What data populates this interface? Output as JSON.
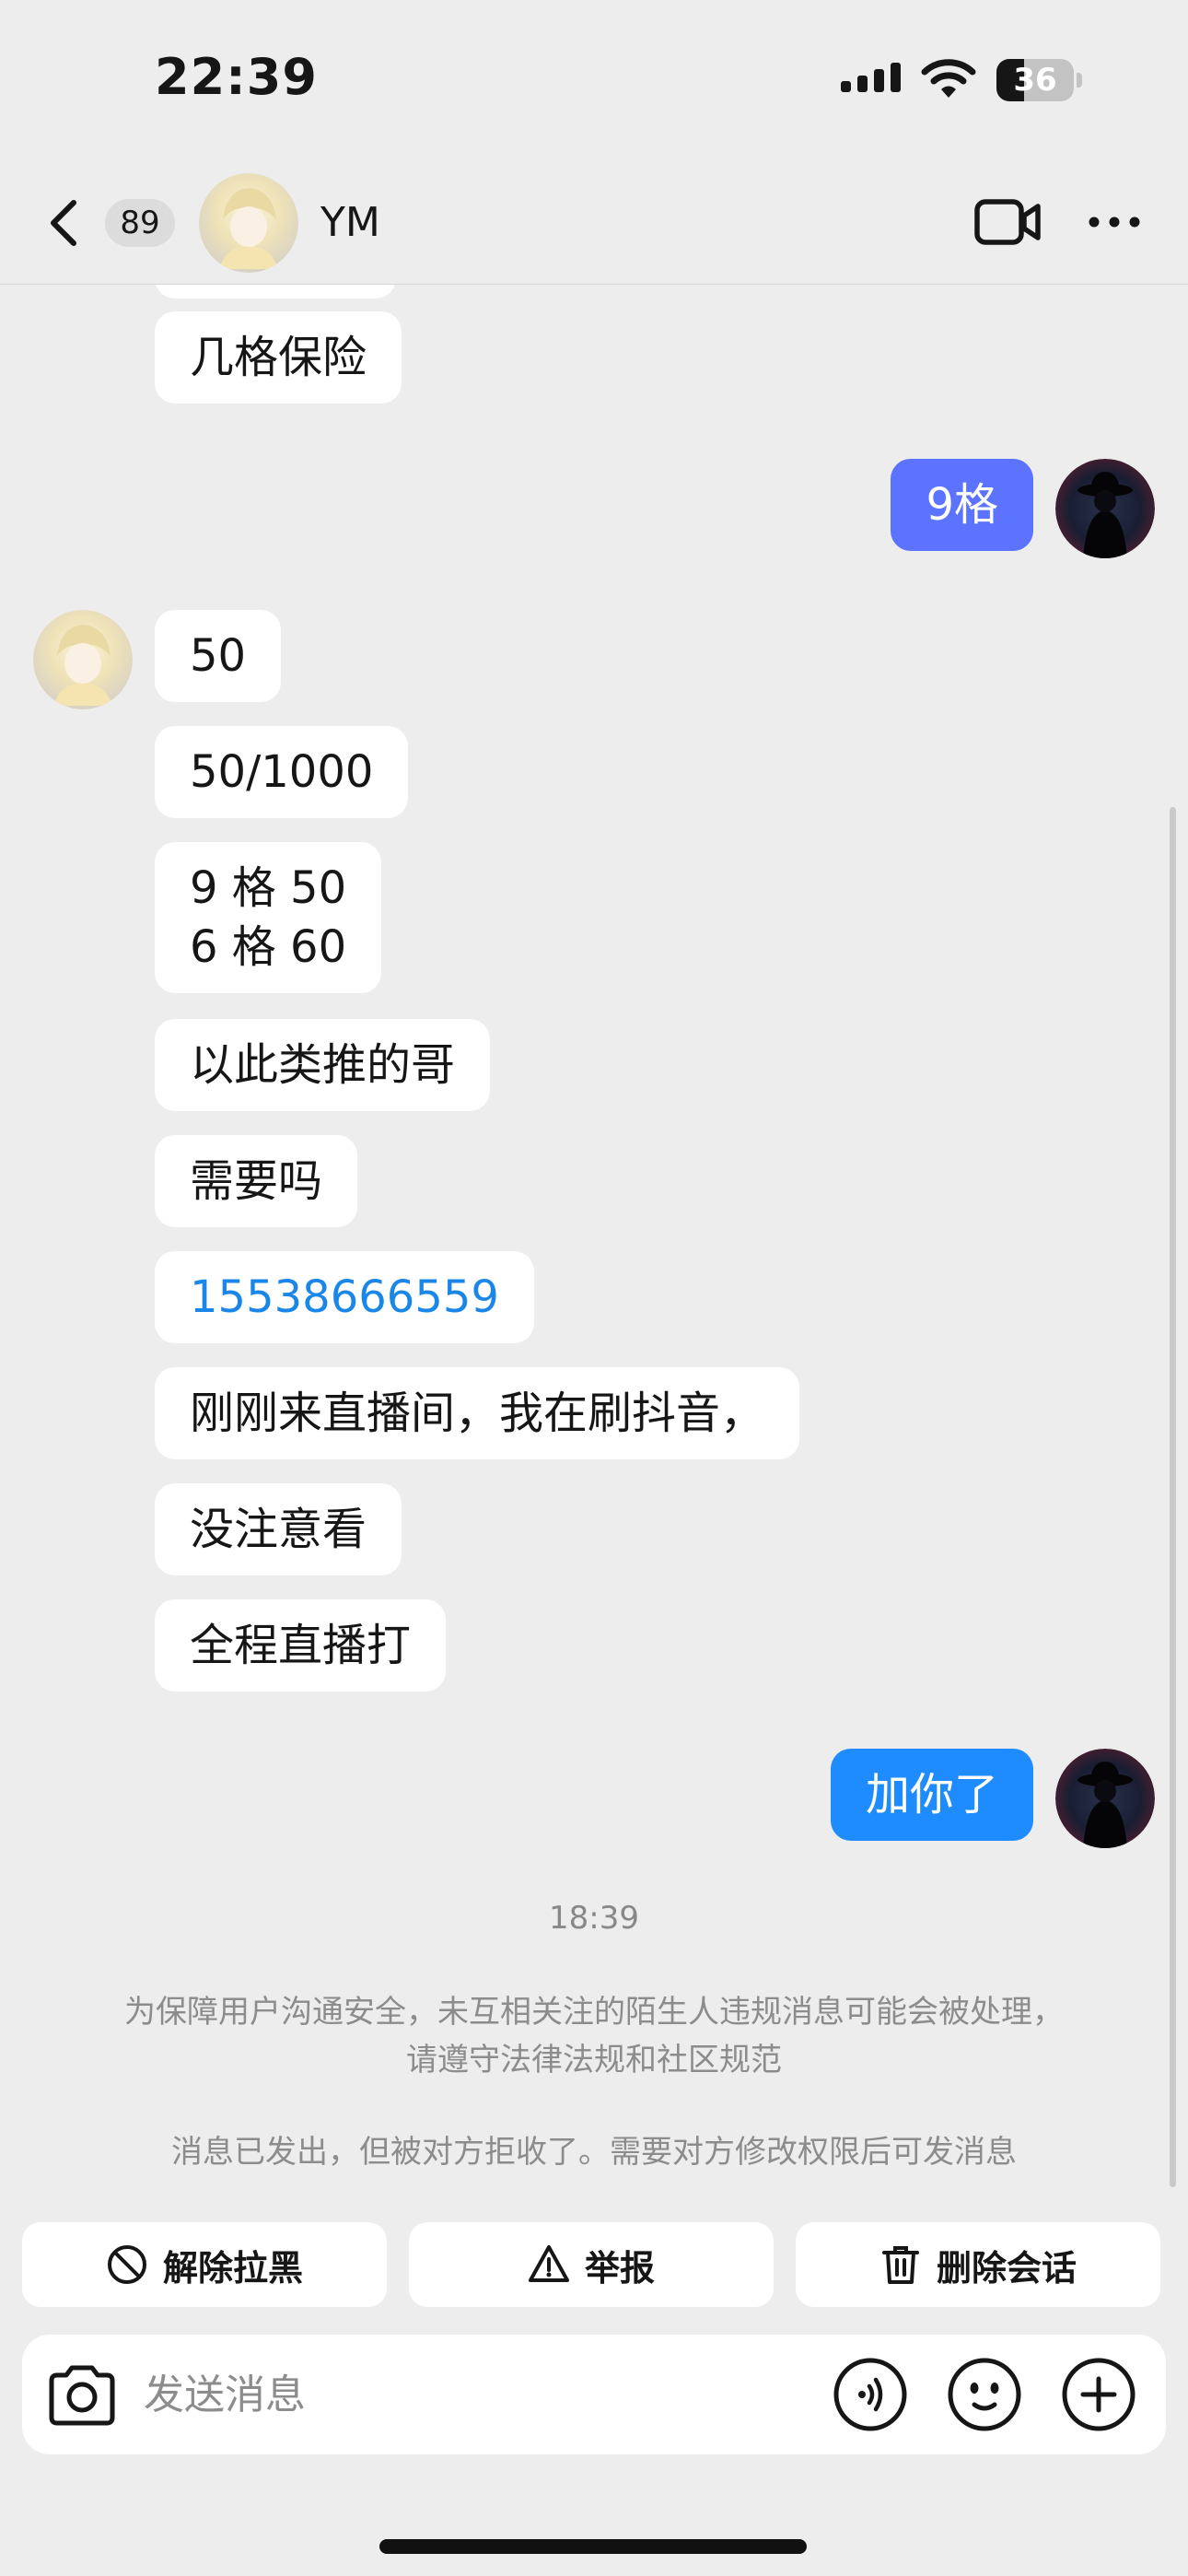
{
  "status_bar": {
    "time": "22:39",
    "battery": "36",
    "battery_level": 0.36
  },
  "header": {
    "unread_count": "89",
    "contact_name": "YM"
  },
  "messages": [
    {
      "dir": "in",
      "text": "几格保险"
    },
    {
      "dir": "out",
      "text": "9格"
    },
    {
      "dir": "in",
      "text": "50"
    },
    {
      "dir": "in",
      "text": "50/1000"
    },
    {
      "dir": "in",
      "text": "9 格 50\n6 格 60"
    },
    {
      "dir": "in",
      "text": "以此类推的哥"
    },
    {
      "dir": "in",
      "text": "需要吗"
    },
    {
      "dir": "in",
      "text": "15538666559",
      "link": true
    },
    {
      "dir": "in",
      "text": "刚刚来直播间，我在刷抖音，"
    },
    {
      "dir": "in",
      "text": "没注意看"
    },
    {
      "dir": "in",
      "text": "全程直播打"
    },
    {
      "dir": "out",
      "text": "加你了"
    }
  ],
  "timestamp": "18:39",
  "notices": {
    "safety": "为保障用户沟通安全，未互相关注的陌生人违规消息可能会被处理，请遵守法律法规和社区规范",
    "rejected": "消息已发出，但被对方拒收了。需要对方修改权限后可发消息"
  },
  "actions": {
    "unblock": "解除拉黑",
    "report": "举报",
    "delete": "删除会话"
  },
  "input": {
    "placeholder": "发送消息"
  },
  "colors": {
    "outgoing_bubble": "#1e8bff",
    "outgoing_bubble_alt": "#5b73ff",
    "link": "#1a86e8",
    "background": "#ededed"
  },
  "icons": [
    "back-icon",
    "video-call-icon",
    "more-icon",
    "block-icon",
    "warning-icon",
    "trash-icon",
    "camera-icon",
    "voice-icon",
    "emoji-icon",
    "plus-icon"
  ]
}
